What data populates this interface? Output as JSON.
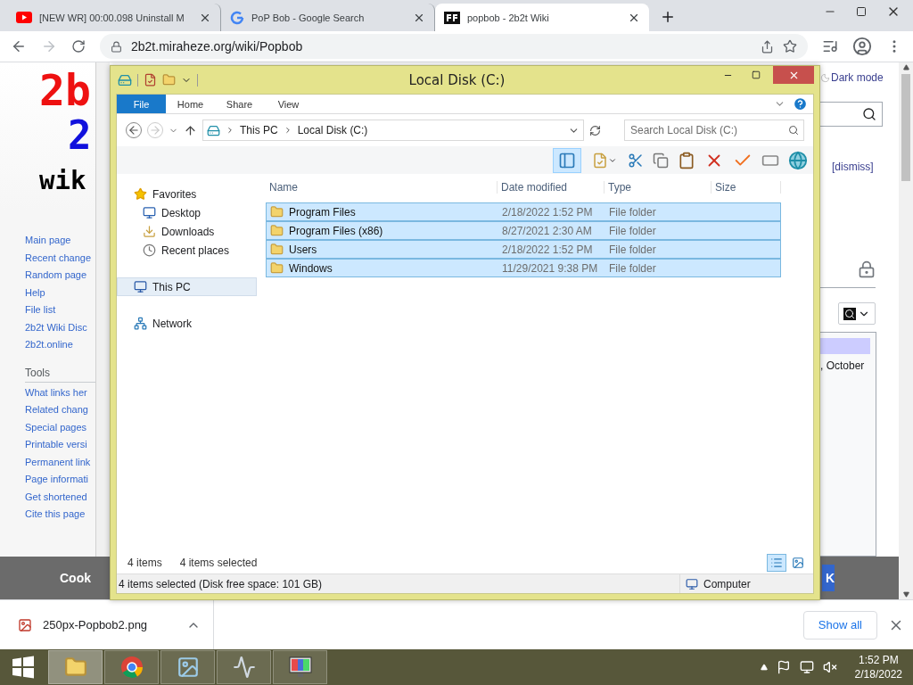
{
  "browser": {
    "tabs": [
      {
        "kind": "youtube",
        "title": "[NEW WR] 00:00.098 Uninstall M",
        "selected": false
      },
      {
        "kind": "google",
        "title": "PoP Bob - Google Search",
        "selected": false
      },
      {
        "kind": "wiki",
        "title": "popbob - 2b2t Wiki",
        "selected": true
      }
    ],
    "url": "2b2t.miraheze.org/wiki/Popbob",
    "forward_disabled": true
  },
  "wiki": {
    "logo": [
      {
        "text": "2b",
        "color": "#ee1111"
      },
      {
        "text": "2",
        "color": "#1111dd"
      },
      {
        "text": "wik",
        "color": "#000000"
      }
    ],
    "nav_links": [
      "Main page",
      "Recent change",
      "Random page",
      "Help",
      "File list",
      "2b2t Wiki Disc",
      "2b2t.online"
    ],
    "tools_heading": "Tools",
    "tools_links": [
      "What links her",
      "Related chang",
      "Special pages",
      "Printable versi",
      "Permanent link",
      "Page informati",
      "Get shortened",
      "Cite this page"
    ],
    "dark_mode": "Dark mode",
    "dismiss": "[dismiss]",
    "fragment": ", October",
    "cookie_text": "Cook",
    "cookie_button": "K"
  },
  "explorer": {
    "title": "Local Disk (C:)",
    "ribbon_tabs": [
      {
        "label": "File",
        "selected": true
      },
      {
        "label": "Home",
        "selected": false
      },
      {
        "label": "Share",
        "selected": false
      },
      {
        "label": "View",
        "selected": false
      }
    ],
    "forward_disabled": true,
    "breadcrumb": [
      "This PC",
      "Local Disk (C:)"
    ],
    "search_placeholder": "Search Local Disk (C:)",
    "preview_pane_on": true,
    "columns": [
      "Name",
      "Date modified",
      "Type",
      "Size"
    ],
    "rows": [
      {
        "name": "Program Files",
        "date": "2/18/2022 1:52 PM",
        "type": "File folder",
        "selected": true
      },
      {
        "name": "Program Files (x86)",
        "date": "8/27/2021 2:30 AM",
        "type": "File folder",
        "selected": true
      },
      {
        "name": "Users",
        "date": "2/18/2022 1:52 PM",
        "type": "File folder",
        "selected": true
      },
      {
        "name": "Windows",
        "date": "11/29/2021 9:38 PM",
        "type": "File folder",
        "selected": true
      }
    ],
    "nav": [
      {
        "kind": "favorites",
        "label": "Favorites",
        "selected": false,
        "children": [
          {
            "kind": "desktop",
            "label": "Desktop",
            "selected": false
          },
          {
            "kind": "downloads",
            "label": "Downloads",
            "selected": false
          },
          {
            "kind": "recent",
            "label": "Recent places",
            "selected": false
          }
        ]
      },
      {
        "kind": "pc",
        "label": "This PC",
        "selected": true
      },
      {
        "kind": "network",
        "label": "Network",
        "selected": false
      }
    ],
    "item_count": "4 items",
    "selection_count": "4 items selected",
    "views": [
      {
        "kind": "details",
        "selected": true
      },
      {
        "kind": "large_icons",
        "selected": false
      }
    ],
    "status_text": "4 items selected (Disk free space: 101 GB)",
    "status_location": "Computer"
  },
  "downloads": {
    "file": "250px-Popbob2.png",
    "show_all": "Show all"
  },
  "taskbar": {
    "apps": [
      {
        "kind": "explorer",
        "selected": true
      },
      {
        "kind": "chrome",
        "selected": false
      },
      {
        "kind": "photos",
        "selected": false
      },
      {
        "kind": "monitor",
        "selected": false
      },
      {
        "kind": "display",
        "selected": false
      }
    ],
    "time": "1:52 PM",
    "date": "2/18/2022"
  }
}
